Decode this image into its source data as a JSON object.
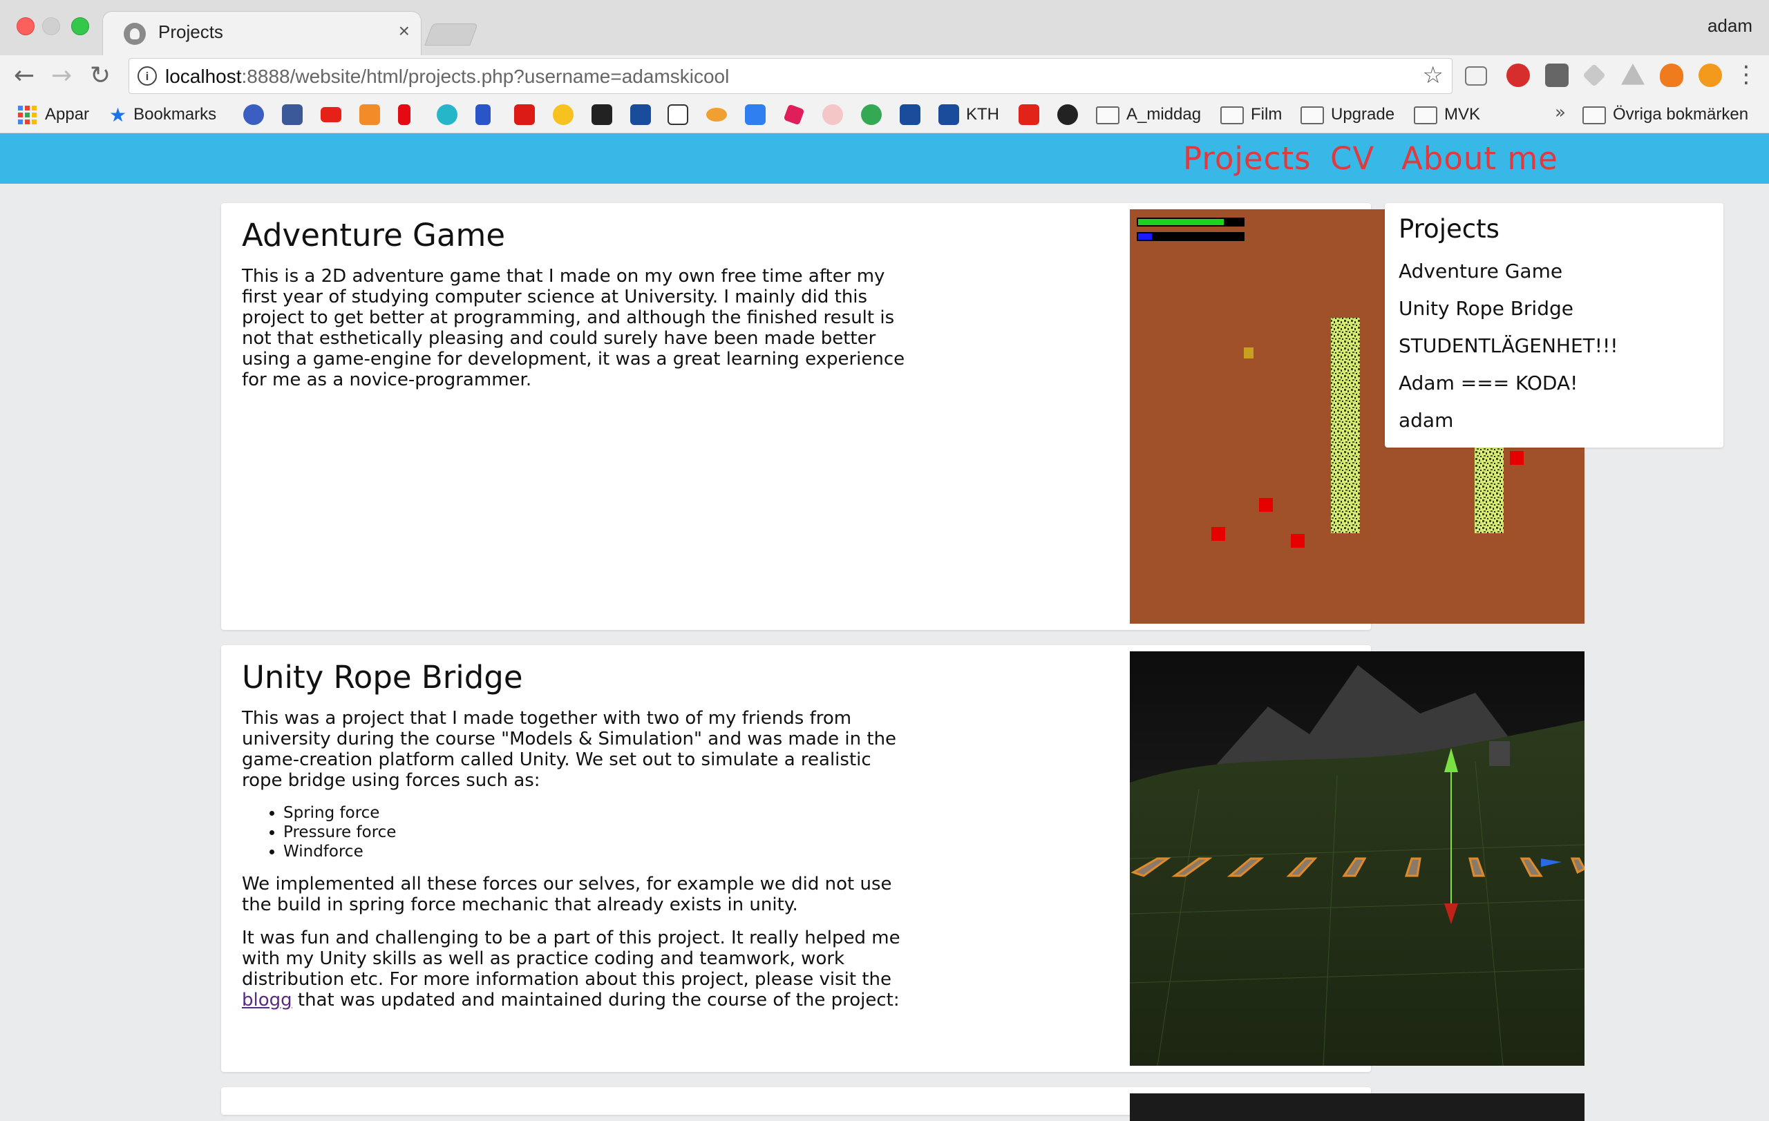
{
  "browser": {
    "tab_title": "Projects",
    "tab_close": "×",
    "profile_name": "adam",
    "url_host": "localhost",
    "url_rest": ":8888/website/html/projects.php?username=adamskicool",
    "bookmarks": {
      "apps": "Appar",
      "bookmarks": "Bookmarks",
      "kth": "KTH",
      "a_middag": "A_middag",
      "film": "Film",
      "upgrade": "Upgrade",
      "mvk": "MVK",
      "more": "»",
      "other": "Övriga bokmärken"
    },
    "colors": {
      "tabstrip": "#dedede",
      "toolbar": "#f2f2f2"
    }
  },
  "site_nav": {
    "projects": "Projects",
    "cv": "CV",
    "about": "About me",
    "colors": {
      "background": "#37b8e6",
      "link": "#e0393e"
    }
  },
  "projects": [
    {
      "title": "Adventure Game",
      "paragraphs": [
        "This is a 2D adventure game that I made on my own free time after my first year of studying computer science at University. I mainly did this project to get better at programming, and although the finished result is not that esthetically pleasing and could surely have been made better using a game-engine for development, it was a great learning experience for me as a novice-programmer."
      ]
    },
    {
      "title": "Unity Rope Bridge",
      "intro": "This was a project that I made together with two of my friends from university during the course \"Models & Simulation\" and was made in the game-creation platform called Unity. We set out to simulate a realistic rope bridge using forces such as:",
      "forces": [
        "Spring force",
        "Pressure force",
        "Windforce"
      ],
      "p2": "We implemented all these forces our selves, for example we did not use the build in spring force mechanic that already exists in unity.",
      "p3_before": "It was fun and challenging to be a part of this project. It really helped me with my Unity skills as well as practice coding and teamwork, work distribution etc. For more information about this project, please visit the ",
      "p3_link": "blogg",
      "p3_after": " that was updated and maintained during the course of the project:"
    }
  ],
  "sidebar": {
    "title": "Projects",
    "items": [
      "Adventure Game",
      "Unity Rope Bridge",
      "STUDENTLÄGENHET!!!",
      "Adam === KODA!",
      "adam"
    ]
  }
}
